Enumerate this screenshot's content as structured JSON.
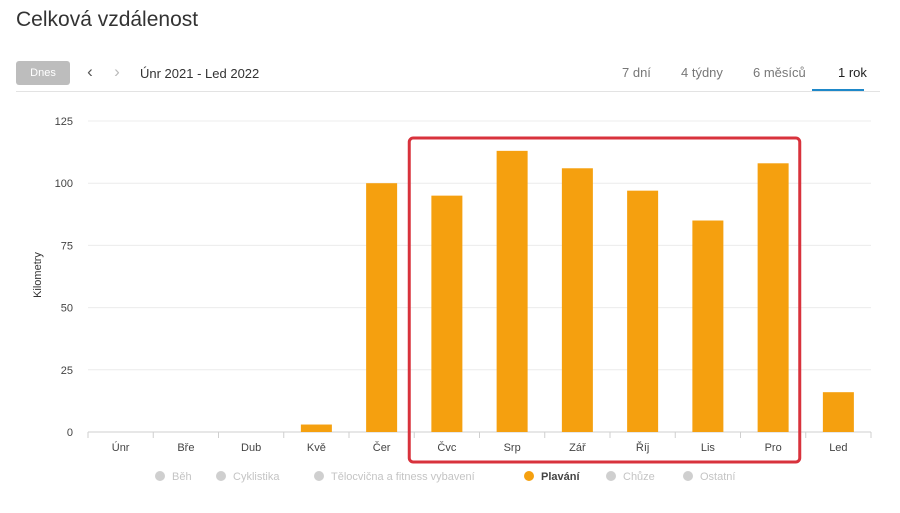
{
  "title": "Celková vzdálenost",
  "toolbar": {
    "today_label": "Dnes",
    "prev_icon": "‹",
    "next_icon": "›",
    "range_label": "Únr 2021 - Led 2022",
    "tabs": [
      {
        "label": "7 dní",
        "active": false
      },
      {
        "label": "4 týdny",
        "active": false
      },
      {
        "label": "6 měsíců",
        "active": false
      },
      {
        "label": "1 rok",
        "active": true
      }
    ]
  },
  "colors": {
    "bar": "#f5a00f",
    "highlight_box": "#d8323c",
    "active_tab_underline": "#1e88c9",
    "inactive_legend": "#cfcfcf"
  },
  "chart_data": {
    "type": "bar",
    "title": "",
    "xlabel": "",
    "ylabel": "Kilometry",
    "ylim": [
      0,
      125
    ],
    "yticks": [
      0,
      25,
      50,
      75,
      100,
      125
    ],
    "grid": true,
    "categories": [
      "Únr",
      "Bře",
      "Dub",
      "Kvě",
      "Čer",
      "Čvc",
      "Srp",
      "Zář",
      "Říj",
      "Lis",
      "Pro",
      "Led"
    ],
    "series": [
      {
        "name": "Plavání",
        "values": [
          0,
          0,
          0,
          3,
          100,
          95,
          113,
          106,
          97,
          85,
          108,
          16
        ]
      }
    ],
    "highlight": {
      "from": "Čvc",
      "to": "Pro"
    },
    "legend_position": "bottom",
    "legend": [
      {
        "label": "Běh",
        "active": false
      },
      {
        "label": "Cyklistika",
        "active": false
      },
      {
        "label": "Tělocvična a fitness vybavení",
        "active": false
      },
      {
        "label": "Plavání",
        "active": true
      },
      {
        "label": "Chůze",
        "active": false
      },
      {
        "label": "Ostatní",
        "active": false
      }
    ]
  }
}
